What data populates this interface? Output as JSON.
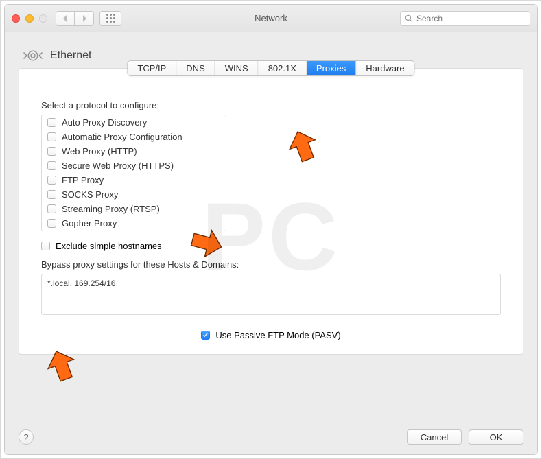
{
  "window": {
    "title": "Network"
  },
  "search": {
    "placeholder": "Search"
  },
  "header": {
    "interface": "Ethernet"
  },
  "tabs": [
    {
      "label": "TCP/IP",
      "active": false
    },
    {
      "label": "DNS",
      "active": false
    },
    {
      "label": "WINS",
      "active": false
    },
    {
      "label": "802.1X",
      "active": false
    },
    {
      "label": "Proxies",
      "active": true
    },
    {
      "label": "Hardware",
      "active": false
    }
  ],
  "protocols": {
    "title": "Select a protocol to configure:",
    "items": [
      {
        "label": "Auto Proxy Discovery",
        "checked": false
      },
      {
        "label": "Automatic Proxy Configuration",
        "checked": false
      },
      {
        "label": "Web Proxy (HTTP)",
        "checked": false
      },
      {
        "label": "Secure Web Proxy (HTTPS)",
        "checked": false
      },
      {
        "label": "FTP Proxy",
        "checked": false
      },
      {
        "label": "SOCKS Proxy",
        "checked": false
      },
      {
        "label": "Streaming Proxy (RTSP)",
        "checked": false
      },
      {
        "label": "Gopher Proxy",
        "checked": false
      }
    ]
  },
  "exclude": {
    "label": "Exclude simple hostnames",
    "checked": false
  },
  "bypass": {
    "label": "Bypass proxy settings for these Hosts & Domains:",
    "value": "*.local, 169.254/16"
  },
  "pasv": {
    "label": "Use Passive FTP Mode (PASV)",
    "checked": true
  },
  "footer": {
    "help": "?",
    "cancel": "Cancel",
    "ok": "OK"
  }
}
